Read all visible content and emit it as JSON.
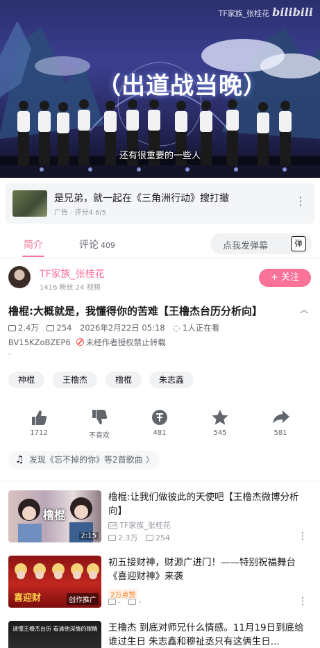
{
  "player": {
    "video_title": "（出道战当晚）",
    "subtitle": "还有很重要的一些人",
    "watermark_channel": "TF家族_张桂花",
    "watermark_logo": "bilibili"
  },
  "ad": {
    "title": "是兄弟，就一起在《三角洲行动》搜打撤",
    "meta": "广告 · 评分4.6/5",
    "more_icon": "more-vertical-icon"
  },
  "tabs": {
    "intro": "简介",
    "comments": "评论",
    "comment_count": "409",
    "danmaku_placeholder": "点我发弹幕",
    "danmaku_icon_label": "弹"
  },
  "uploader": {
    "name": "TF家族_张桂花",
    "stats": "1416 粉丝  24 视频",
    "follow": "+ 关注"
  },
  "video": {
    "title": "橹棍:大概就是，我懂得你的苦难【王橹杰台历分析向】",
    "views": "2.4万",
    "danmaku": "254",
    "date": "2026年2月22日 05:18",
    "watching": "1人正在看",
    "bvid": "BV15KZoBZEP6",
    "copyright": "未经作者授权禁止转载",
    "desc": "-"
  },
  "tags": [
    "神棍",
    "王橹杰",
    "橹棍",
    "朱志鑫"
  ],
  "actions": {
    "like": "1712",
    "dislike": "不喜欢",
    "coin": "481",
    "favorite": "545",
    "share": "581"
  },
  "music": {
    "text": "发现《忘不掉的你》等2首歌曲"
  },
  "recommendations": [
    {
      "title": "橹棍:让我们做彼此的天使吧【王橹杰微博分析向】",
      "thumb_label": "橹棍",
      "duration": "2:15",
      "uploader": "TF家族_张桂花",
      "views": "2.3万",
      "danmaku": "254"
    },
    {
      "title": "初五接财神，财源广进门！——特别祝福舞台《喜迎财神》来袭",
      "thumb_label": "喜迎财",
      "promo": "创作推广",
      "badge": "2万点赞",
      "views": "-",
      "danmaku": "-"
    },
    {
      "title": "王橹杰 到底对师兄什么情感。11月19日到底给谁过生日 朱志鑫和穆祉丞只有这俩生日...",
      "thumb_label": "请懂王橹杰台历 看清他深情的眼睛"
    }
  ],
  "colors": {
    "brand_pink": "#fb7299",
    "text_primary": "#18191c",
    "text_secondary": "#61666d",
    "text_muted": "#9499a0",
    "chip_bg": "#f1f2f3"
  }
}
